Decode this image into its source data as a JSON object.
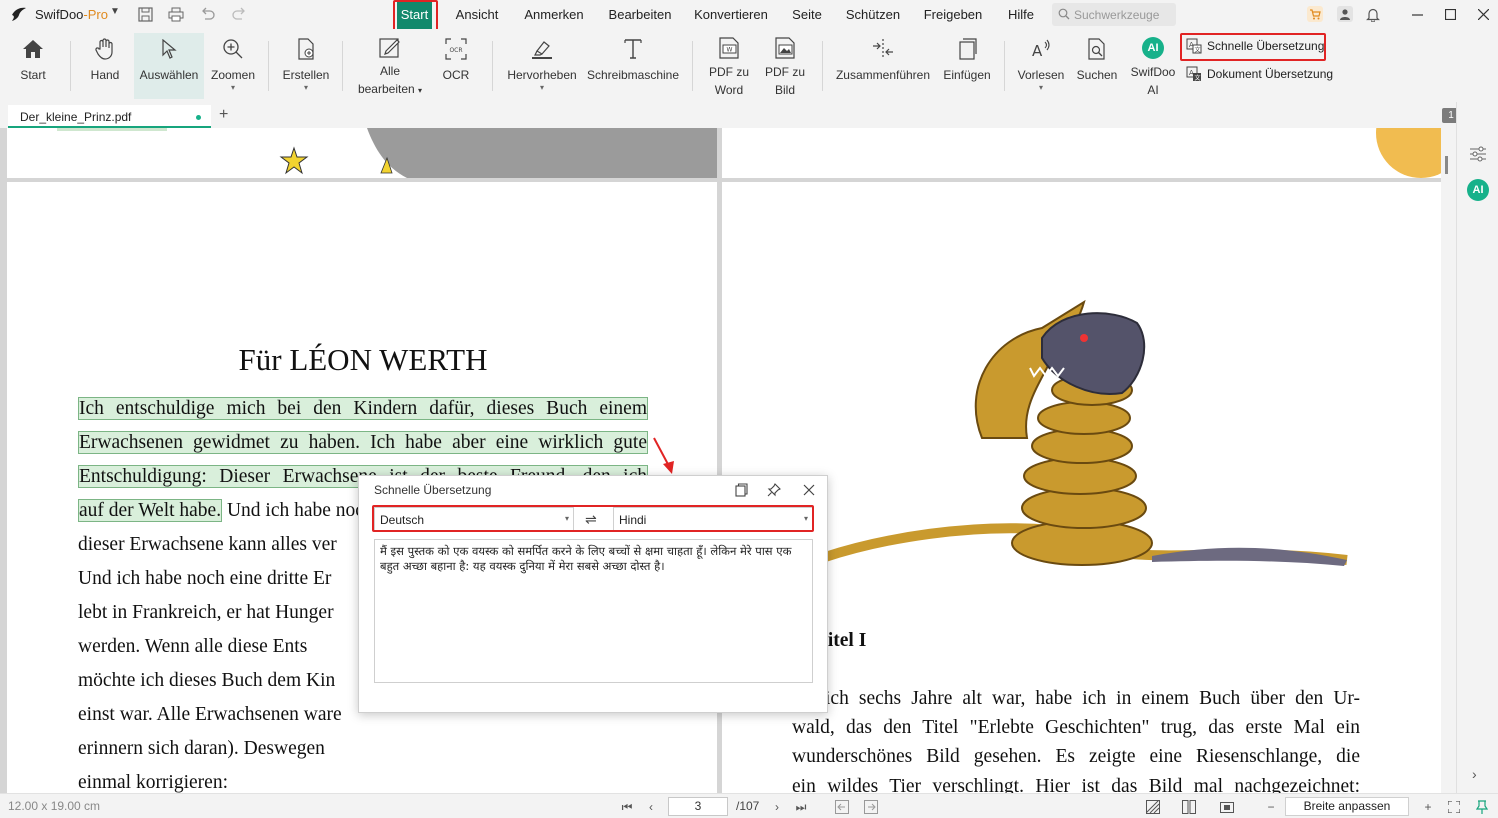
{
  "app": {
    "name": "SwifDoo",
    "edition": "-Pro",
    "search_placeholder": "Suchwerkzeuge"
  },
  "menu": [
    {
      "label": "Start",
      "active": true
    },
    {
      "label": "Ansicht"
    },
    {
      "label": "Anmerken"
    },
    {
      "label": "Bearbeiten"
    },
    {
      "label": "Konvertieren"
    },
    {
      "label": "Seite"
    },
    {
      "label": "Schützen"
    },
    {
      "label": "Freigeben"
    },
    {
      "label": "Hilfe"
    }
  ],
  "ribbon": {
    "start": "Start",
    "hand": "Hand",
    "select": "Auswählen",
    "zoom": "Zoomen",
    "create": "Erstellen",
    "edit_all_1": "Alle",
    "edit_all_2": "bearbeiten",
    "ocr": "OCR",
    "highlight": "Hervorheben",
    "typewriter": "Schreibmaschine",
    "pdf_word_1": "PDF zu",
    "pdf_word_2": "Word",
    "pdf_image_1": "PDF zu",
    "pdf_image_2": "Bild",
    "merge": "Zusammenführen",
    "insert": "Einfügen",
    "read_aloud": "Vorlesen",
    "search": "Suchen",
    "ai_1": "SwifDoo",
    "ai_2": "AI",
    "ai_badge": "AI",
    "quick_translation": "Schnelle Übersetzung",
    "doc_translation": "Dokument Übersetzung"
  },
  "tab": {
    "filename": "Der_kleine_Prinz.pdf",
    "page_count_badge": "1"
  },
  "left_page": {
    "heading": "Für LÉON WERTH",
    "lines": [
      {
        "hl": "Ich entschuldige mich bei den Kindern dafür, dieses Buch einem",
        "rest": ""
      },
      {
        "hl": "Erwachsenen gewidmet zu haben. Ich habe aber eine wirklich gute",
        "rest": ""
      },
      {
        "hl": "Entschuldigung: Dieser Erwachsene ist der beste Freund, den ich",
        "rest": ""
      },
      {
        "hl": "auf der Welt habe.",
        "rest": " Und ich habe noch eine andere Entschuldigung:"
      },
      {
        "hl": "",
        "rest": "dieser Erwachsene kann alles ver"
      },
      {
        "hl": "",
        "rest": "Und ich habe noch eine dritte Er"
      },
      {
        "hl": "",
        "rest": "lebt in Frankreich, er hat Hunger"
      },
      {
        "hl": "",
        "rest": "werden. Wenn alle diese Ents"
      },
      {
        "hl": "",
        "rest": "möchte ich dieses Buch dem Kin"
      },
      {
        "hl": "",
        "rest": "einst war. Alle Erwachsenen ware"
      },
      {
        "hl": "",
        "rest": "erinnern sich daran). Deswegen"
      },
      {
        "hl": "",
        "rest": "einmal korrigieren:"
      }
    ]
  },
  "right_page": {
    "chapter": "pitel I",
    "lines": [
      "ich sechs Jahre alt war, habe ich in einem Buch über den Ur-",
      "wald, das den Titel \"Erlebte Geschichten\" trug, das erste Mal ein",
      "wunderschönes Bild gesehen. Es zeigte eine Riesenschlange, die",
      "ein wildes Tier verschlingt. Hier ist das Bild mal nachgezeichnet:"
    ]
  },
  "popup": {
    "title": "Schnelle Übersetzung",
    "source_lang": "Deutsch",
    "target_lang": "Hindi",
    "result": "मैं इस पुस्तक को एक वयस्क को समर्पित करने के लिए बच्चों से क्षमा चाहता हूँ। लेकिन मेरे पास एक बहुत अच्छा बहाना है: यह वयस्क दुनिया में मेरा सबसे अच्छा दोस्त है।"
  },
  "status": {
    "page_size": "12.00 x 19.00 cm",
    "current_page": "3",
    "total_pages": "/107",
    "fit": "Breite anpassen"
  },
  "colors": {
    "accent": "#12896c",
    "highlight_annotation": "#e12424",
    "text_highlight": "#d9efdb"
  }
}
